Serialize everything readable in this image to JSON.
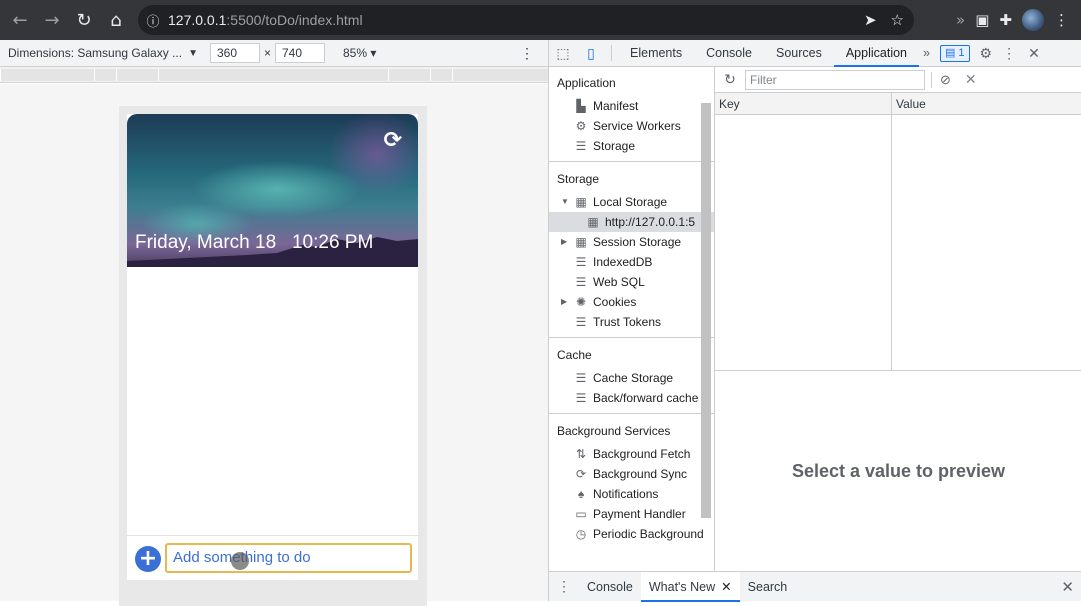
{
  "browser": {
    "url_host": "127.0.0.1",
    "url_rest": ":5500/toDo/index.html"
  },
  "device_toolbar": {
    "dimensions_label": "Dimensions: Samsung Galaxy ...",
    "width": "360",
    "height": "740",
    "zoom": "85%"
  },
  "app": {
    "date": "Friday, March 18",
    "time": "10:26 PM",
    "input_placeholder": "Add something to do"
  },
  "devtools": {
    "tabs": [
      "Elements",
      "Console",
      "Sources",
      "Application"
    ],
    "active_tab": "Application",
    "badge_count": "1",
    "sidebar": {
      "application_title": "Application",
      "application_items": [
        "Manifest",
        "Service Workers",
        "Storage"
      ],
      "storage_title": "Storage",
      "local_storage": "Local Storage",
      "local_storage_origin": "http://127.0.0.1:5",
      "storage_items": [
        "Session Storage",
        "IndexedDB",
        "Web SQL",
        "Cookies",
        "Trust Tokens"
      ],
      "cache_title": "Cache",
      "cache_items": [
        "Cache Storage",
        "Back/forward cache"
      ],
      "bg_title": "Background Services",
      "bg_items": [
        "Background Fetch",
        "Background Sync",
        "Notifications",
        "Payment Handler",
        "Periodic Background"
      ]
    },
    "filter_placeholder": "Filter",
    "table_headers": {
      "key": "Key",
      "value": "Value"
    },
    "preview_text": "Select a value to preview",
    "drawer_tabs": [
      "Console",
      "What's New",
      "Search"
    ],
    "drawer_active": "What's New"
  }
}
